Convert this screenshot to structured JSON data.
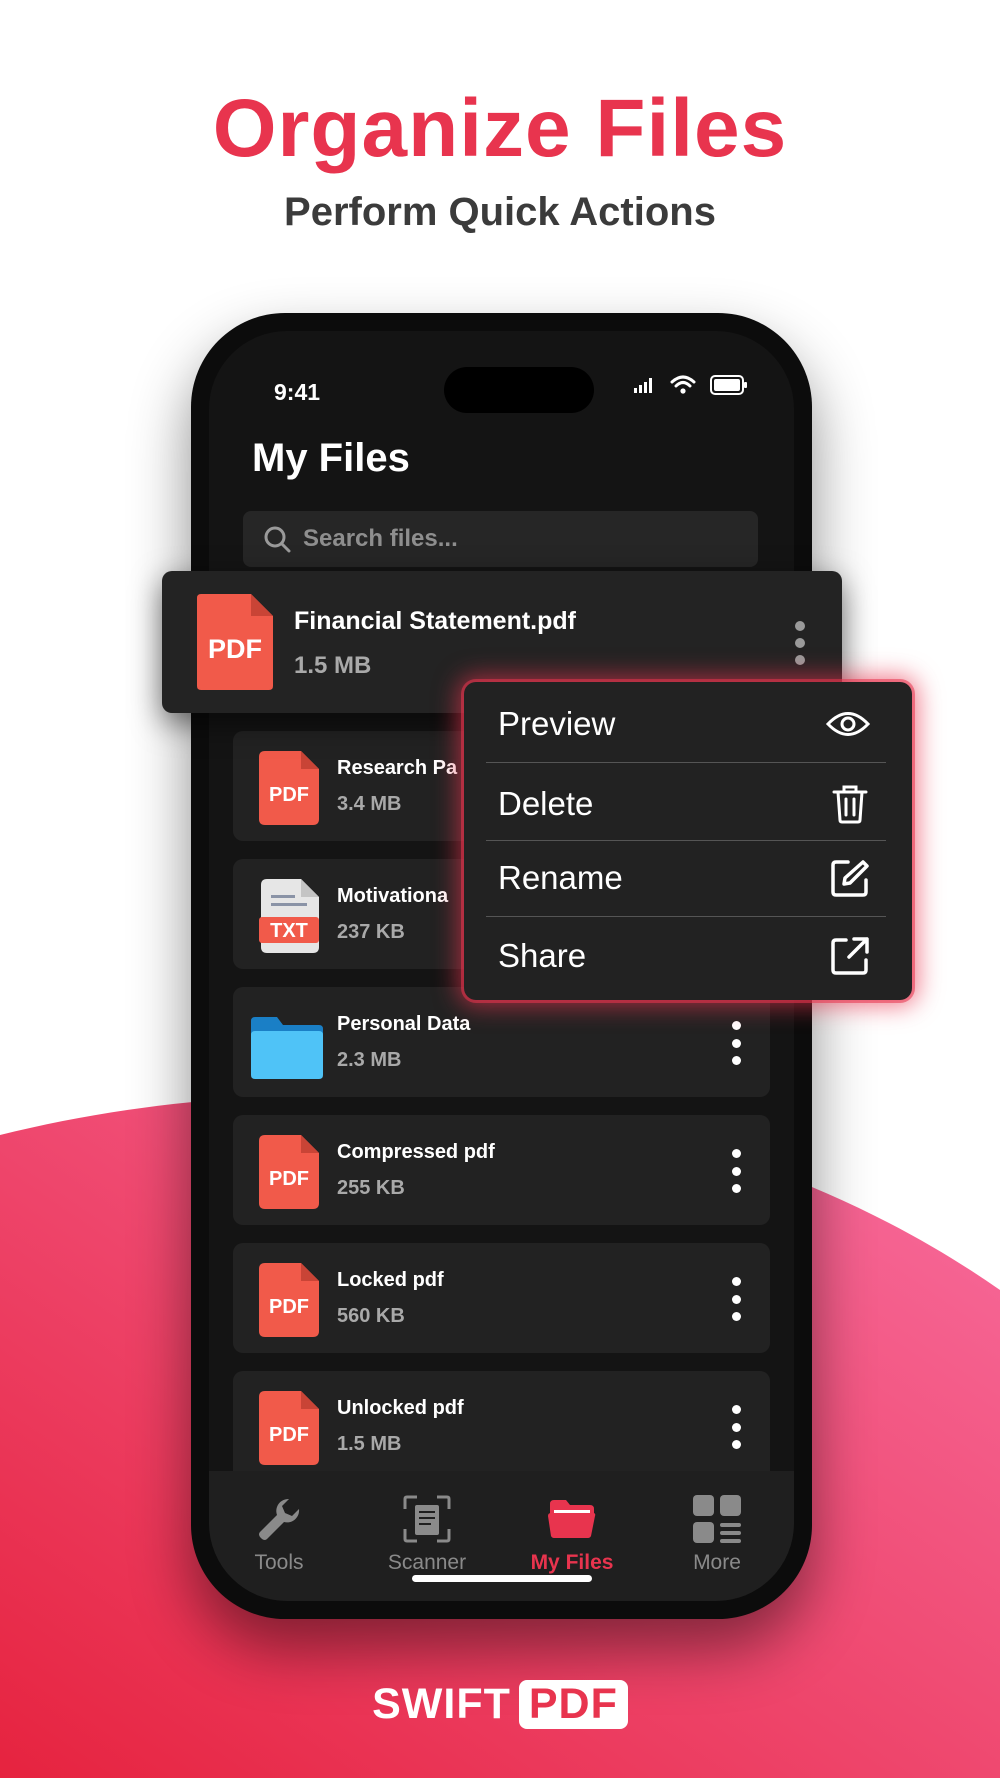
{
  "hero": {
    "title": "Organize Files",
    "subtitle": "Perform Quick Actions"
  },
  "status_bar": {
    "time": "9:41"
  },
  "screen": {
    "title": "My Files",
    "search_placeholder": "Search files..."
  },
  "featured_file": {
    "name": "Financial Statement.pdf",
    "size": "1.5 MB",
    "icon": "pdf-file-icon",
    "icon_text": "PDF"
  },
  "files": [
    {
      "name": "Research Pa",
      "size": "3.4 MB",
      "type": "pdf",
      "icon_text": "PDF"
    },
    {
      "name": "Motivationa",
      "size": "237 KB",
      "type": "txt",
      "icon_text": "TXT"
    },
    {
      "name": "Personal Data",
      "size": "2.3 MB",
      "type": "folder"
    },
    {
      "name": "Compressed pdf",
      "size": "255 KB",
      "type": "pdf",
      "icon_text": "PDF"
    },
    {
      "name": "Locked pdf",
      "size": "560 KB",
      "type": "pdf",
      "icon_text": "PDF"
    },
    {
      "name": "Unlocked pdf",
      "size": "1.5 MB",
      "type": "pdf",
      "icon_text": "PDF"
    }
  ],
  "context_menu": {
    "items": [
      {
        "label": "Preview",
        "icon": "eye-icon"
      },
      {
        "label": "Delete",
        "icon": "trash-icon"
      },
      {
        "label": "Rename",
        "icon": "edit-icon"
      },
      {
        "label": "Share",
        "icon": "external-link-icon"
      }
    ]
  },
  "tabbar": {
    "tabs": [
      {
        "label": "Tools",
        "icon": "wrench-icon",
        "active": false
      },
      {
        "label": "Scanner",
        "icon": "scanner-icon",
        "active": false
      },
      {
        "label": "My Files",
        "icon": "folder-open-icon",
        "active": true
      },
      {
        "label": "More",
        "icon": "grid-icon",
        "active": false
      }
    ]
  },
  "brand": {
    "word1": "SWIFT",
    "word2": "PDF"
  },
  "colors": {
    "accent": "#e8344e",
    "pdf_red": "#f15a4a",
    "folder_blue": "#4fc3f7",
    "screen_bg": "#141414",
    "row_bg": "#222222"
  }
}
